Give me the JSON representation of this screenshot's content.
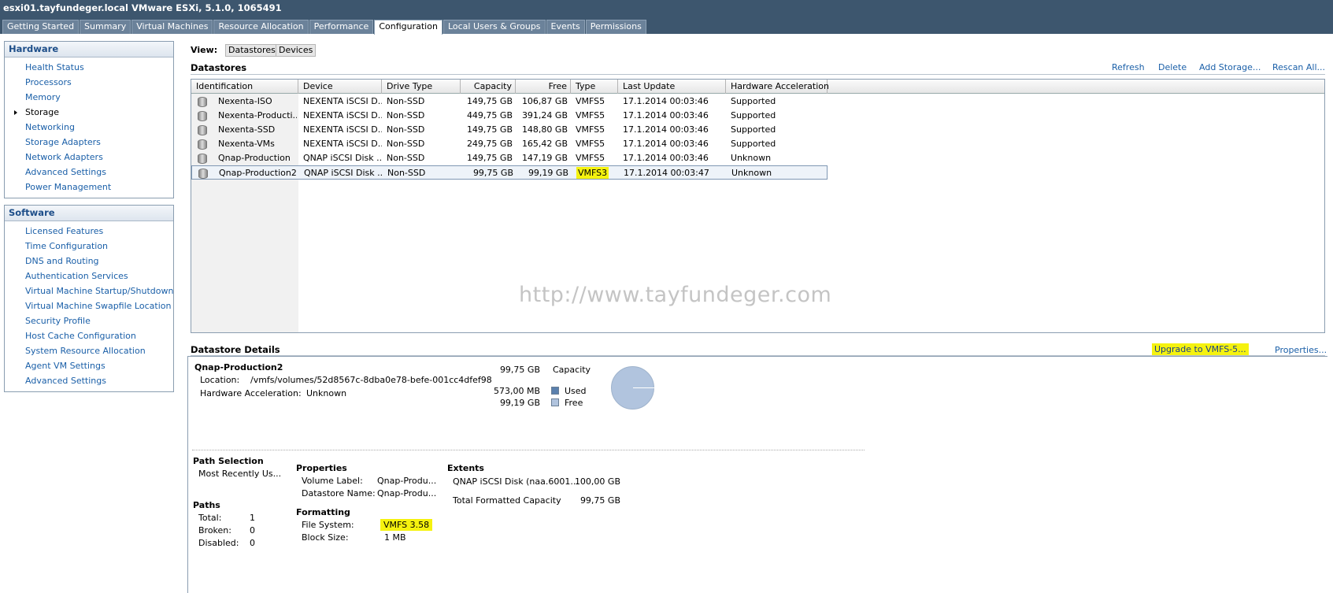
{
  "window": {
    "title": "esxi01.tayfundeger.local VMware ESXi, 5.1.0, 1065491"
  },
  "tabs": [
    {
      "label": "Getting Started"
    },
    {
      "label": "Summary"
    },
    {
      "label": "Virtual Machines"
    },
    {
      "label": "Resource Allocation"
    },
    {
      "label": "Performance"
    },
    {
      "label": "Configuration",
      "active": true
    },
    {
      "label": "Local Users & Groups"
    },
    {
      "label": "Events"
    },
    {
      "label": "Permissions"
    }
  ],
  "hardware": {
    "title": "Hardware",
    "items": [
      {
        "label": "Health Status"
      },
      {
        "label": "Processors"
      },
      {
        "label": "Memory"
      },
      {
        "label": "Storage"
      },
      {
        "label": "Networking"
      },
      {
        "label": "Storage Adapters"
      },
      {
        "label": "Network Adapters"
      },
      {
        "label": "Advanced Settings"
      },
      {
        "label": "Power Management"
      }
    ]
  },
  "software": {
    "title": "Software",
    "items": [
      {
        "label": "Licensed Features"
      },
      {
        "label": "Time Configuration"
      },
      {
        "label": "DNS and Routing"
      },
      {
        "label": "Authentication Services"
      },
      {
        "label": "Virtual Machine Startup/Shutdown"
      },
      {
        "label": "Virtual Machine Swapfile Location"
      },
      {
        "label": "Security Profile"
      },
      {
        "label": "Host Cache Configuration"
      },
      {
        "label": "System Resource Allocation"
      },
      {
        "label": "Agent VM Settings"
      },
      {
        "label": "Advanced Settings"
      }
    ]
  },
  "view": {
    "label": "View:",
    "datastores": "Datastores",
    "devices": "Devices"
  },
  "datastores": {
    "title": "Datastores",
    "actions": {
      "refresh": "Refresh",
      "delete": "Delete",
      "add_storage": "Add Storage...",
      "rescan": "Rescan All..."
    },
    "columns": [
      "Identification",
      "Device",
      "Drive Type",
      "Capacity",
      "Free",
      "Type",
      "Last Update",
      "Hardware Acceleration"
    ],
    "rows": [
      [
        "Nexenta-ISO",
        "NEXENTA iSCSI D...",
        "Non-SSD",
        "149,75 GB",
        "106,87 GB",
        "VMFS5",
        "17.1.2014 00:03:46",
        "Supported"
      ],
      [
        "Nexenta-Producti...",
        "NEXENTA iSCSI D...",
        "Non-SSD",
        "449,75 GB",
        "391,24 GB",
        "VMFS5",
        "17.1.2014 00:03:46",
        "Supported"
      ],
      [
        "Nexenta-SSD",
        "NEXENTA iSCSI D...",
        "Non-SSD",
        "149,75 GB",
        "148,80 GB",
        "VMFS5",
        "17.1.2014 00:03:46",
        "Supported"
      ],
      [
        "Nexenta-VMs",
        "NEXENTA iSCSI D...",
        "Non-SSD",
        "249,75 GB",
        "165,42 GB",
        "VMFS5",
        "17.1.2014 00:03:46",
        "Supported"
      ],
      [
        "Qnap-Production",
        "QNAP iSCSI Disk ...",
        "Non-SSD",
        "149,75 GB",
        "147,19 GB",
        "VMFS5",
        "17.1.2014 00:03:46",
        "Unknown"
      ],
      [
        "Qnap-Production2",
        "QNAP iSCSI Disk ...",
        "Non-SSD",
        "99,75 GB",
        "99,19 GB",
        "VMFS3",
        "17.1.2014 00:03:47",
        "Unknown"
      ]
    ],
    "selected_row": 5,
    "watermark": "http://www.tayfundeger.com"
  },
  "details": {
    "title": "Datastore Details",
    "upgrade": "Upgrade to VMFS-5...",
    "properties_link": "Properties...",
    "name": "Qnap-Production2",
    "location_label": "Location:",
    "location": "/vmfs/volumes/52d8567c-8dba0e78-befe-001cc4dfef98",
    "hw_accel_label": "Hardware Acceleration:",
    "hw_accel": "Unknown",
    "capacity_value": "99,75 GB",
    "capacity_label": "Capacity",
    "used_value": "573,00 MB",
    "used_label": "Used",
    "free_value": "99,19 GB",
    "free_label": "Free",
    "used_fraction": 0.0056,
    "colors": {
      "used": "#5b80ad",
      "free": "#b1c4de"
    },
    "path_selection_title": "Path Selection",
    "path_selection": "Most Recently Us...",
    "paths_title": "Paths",
    "paths_total_label": "Total:",
    "paths_total": "1",
    "paths_broken_label": "Broken:",
    "paths_broken": "0",
    "paths_disabled_label": "Disabled:",
    "paths_disabled": "0",
    "properties_title": "Properties",
    "volume_label_label": "Volume Label:",
    "volume_label": "Qnap-Produ...",
    "datastore_name_label": "Datastore Name:",
    "datastore_name": "Qnap-Produ...",
    "formatting_title": "Formatting",
    "file_system_label": "File System:",
    "file_system": "VMFS 3.58",
    "block_size_label": "Block Size:",
    "block_size": "1 MB",
    "extents_title": "Extents",
    "extent_name": "QNAP iSCSI Disk (naa.6001...",
    "extent_size": "100,00 GB",
    "total_formatted_label": "Total Formatted Capacity",
    "total_formatted": "99,75 GB"
  }
}
